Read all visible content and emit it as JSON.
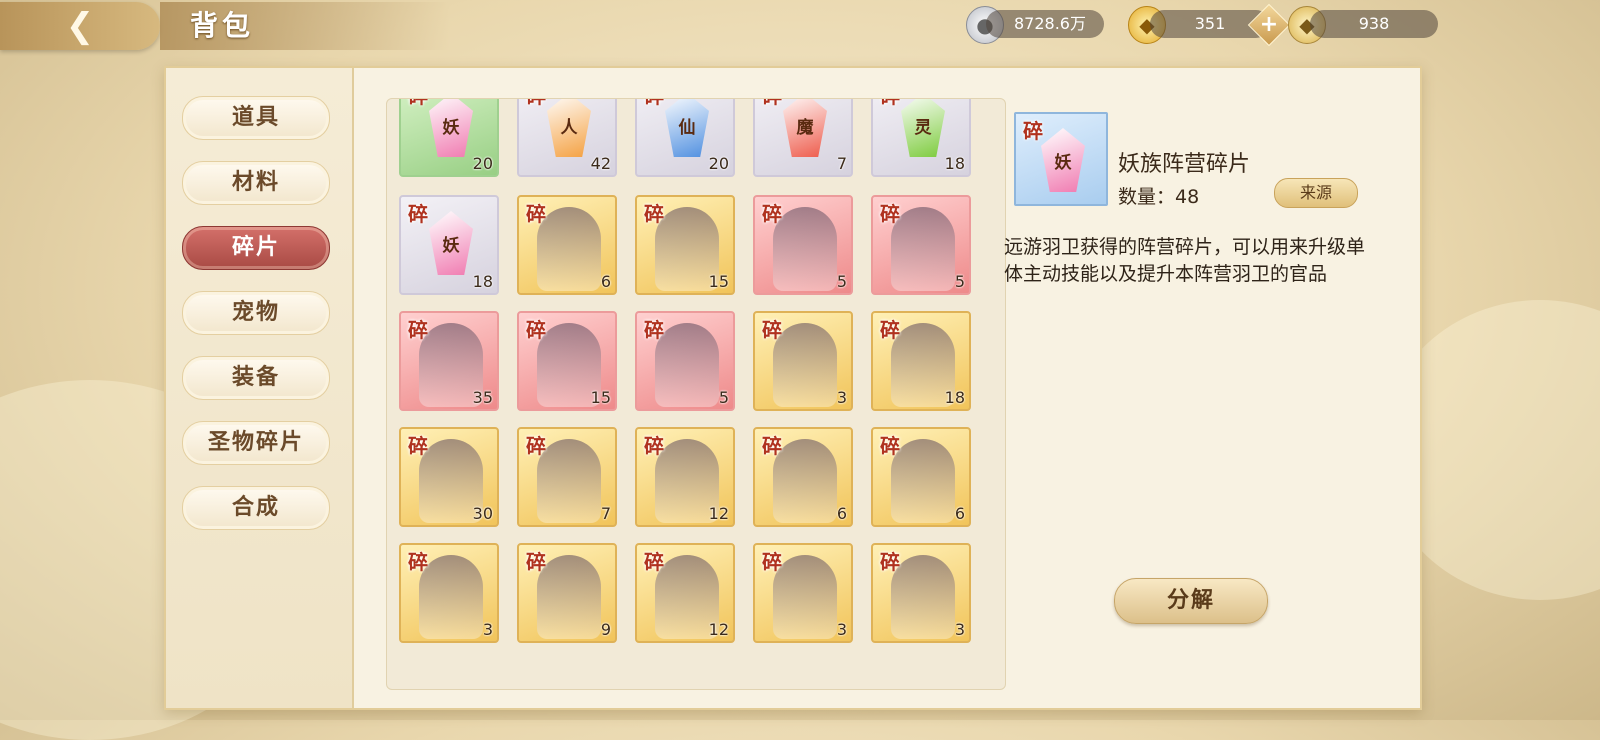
{
  "header": {
    "back_icon": "back-arrow-icon",
    "title": "背包",
    "currencies": [
      {
        "name": "silver",
        "value": "8728.6万",
        "icon": "silver-coin-icon"
      },
      {
        "name": "gold-ingot",
        "value": "351",
        "icon": "gold-ingot-icon"
      },
      {
        "name": "bound-ingot",
        "value": "938",
        "icon": "bound-ingot-icon"
      }
    ],
    "plus_label": "+"
  },
  "sidebar": {
    "tabs": [
      {
        "label": "道具",
        "active": false
      },
      {
        "label": "材料",
        "active": false
      },
      {
        "label": "碎片",
        "active": true
      },
      {
        "label": "宠物",
        "active": false
      },
      {
        "label": "装备",
        "active": false
      },
      {
        "label": "圣物碎片",
        "active": false
      },
      {
        "label": "合成",
        "active": false
      }
    ]
  },
  "grid": {
    "shard_tag": "碎",
    "items": [
      {
        "kind": "crystal",
        "glyph": "妖",
        "count": "20",
        "quality": "green",
        "color": "#f07ab0"
      },
      {
        "kind": "crystal",
        "glyph": "人",
        "count": "42",
        "quality": "white",
        "color": "#f4a040"
      },
      {
        "kind": "crystal",
        "glyph": "仙",
        "count": "20",
        "quality": "white",
        "color": "#4f8fe0"
      },
      {
        "kind": "crystal",
        "glyph": "魔",
        "count": "7",
        "quality": "white",
        "color": "#ee5a4a"
      },
      {
        "kind": "crystal",
        "glyph": "灵",
        "count": "18",
        "quality": "white",
        "color": "#7ccb3c"
      },
      {
        "kind": "crystal",
        "glyph": "妖",
        "count": "18",
        "quality": "white",
        "color": "#f07ab0"
      },
      {
        "kind": "portrait",
        "count": "6",
        "quality": "gold"
      },
      {
        "kind": "portrait",
        "count": "15",
        "quality": "gold"
      },
      {
        "kind": "portrait",
        "count": "5",
        "quality": "red"
      },
      {
        "kind": "portrait",
        "count": "5",
        "quality": "red"
      },
      {
        "kind": "portrait",
        "count": "35",
        "quality": "red"
      },
      {
        "kind": "portrait",
        "count": "15",
        "quality": "red"
      },
      {
        "kind": "portrait",
        "count": "5",
        "quality": "red"
      },
      {
        "kind": "portrait",
        "count": "3",
        "quality": "gold"
      },
      {
        "kind": "portrait",
        "count": "18",
        "quality": "gold"
      },
      {
        "kind": "portrait",
        "count": "30",
        "quality": "gold"
      },
      {
        "kind": "portrait",
        "count": "7",
        "quality": "gold"
      },
      {
        "kind": "portrait",
        "count": "12",
        "quality": "gold"
      },
      {
        "kind": "portrait",
        "count": "6",
        "quality": "gold"
      },
      {
        "kind": "portrait",
        "count": "6",
        "quality": "gold"
      },
      {
        "kind": "portrait",
        "count": "3",
        "quality": "gold"
      },
      {
        "kind": "portrait",
        "count": "9",
        "quality": "gold"
      },
      {
        "kind": "portrait",
        "count": "12",
        "quality": "gold"
      },
      {
        "kind": "portrait",
        "count": "3",
        "quality": "gold"
      },
      {
        "kind": "portrait",
        "count": "3",
        "quality": "gold"
      }
    ]
  },
  "detail": {
    "icon_glyph": "妖",
    "icon_color": "#f07ab0",
    "name": "妖族阵营碎片",
    "quantity": "数量：48",
    "source_label": "来源",
    "description": "远游羽卫获得的阵营碎片，可以用来升级单体主动技能以及提升本阵营羽卫的官品",
    "decompose_label": "分解"
  }
}
